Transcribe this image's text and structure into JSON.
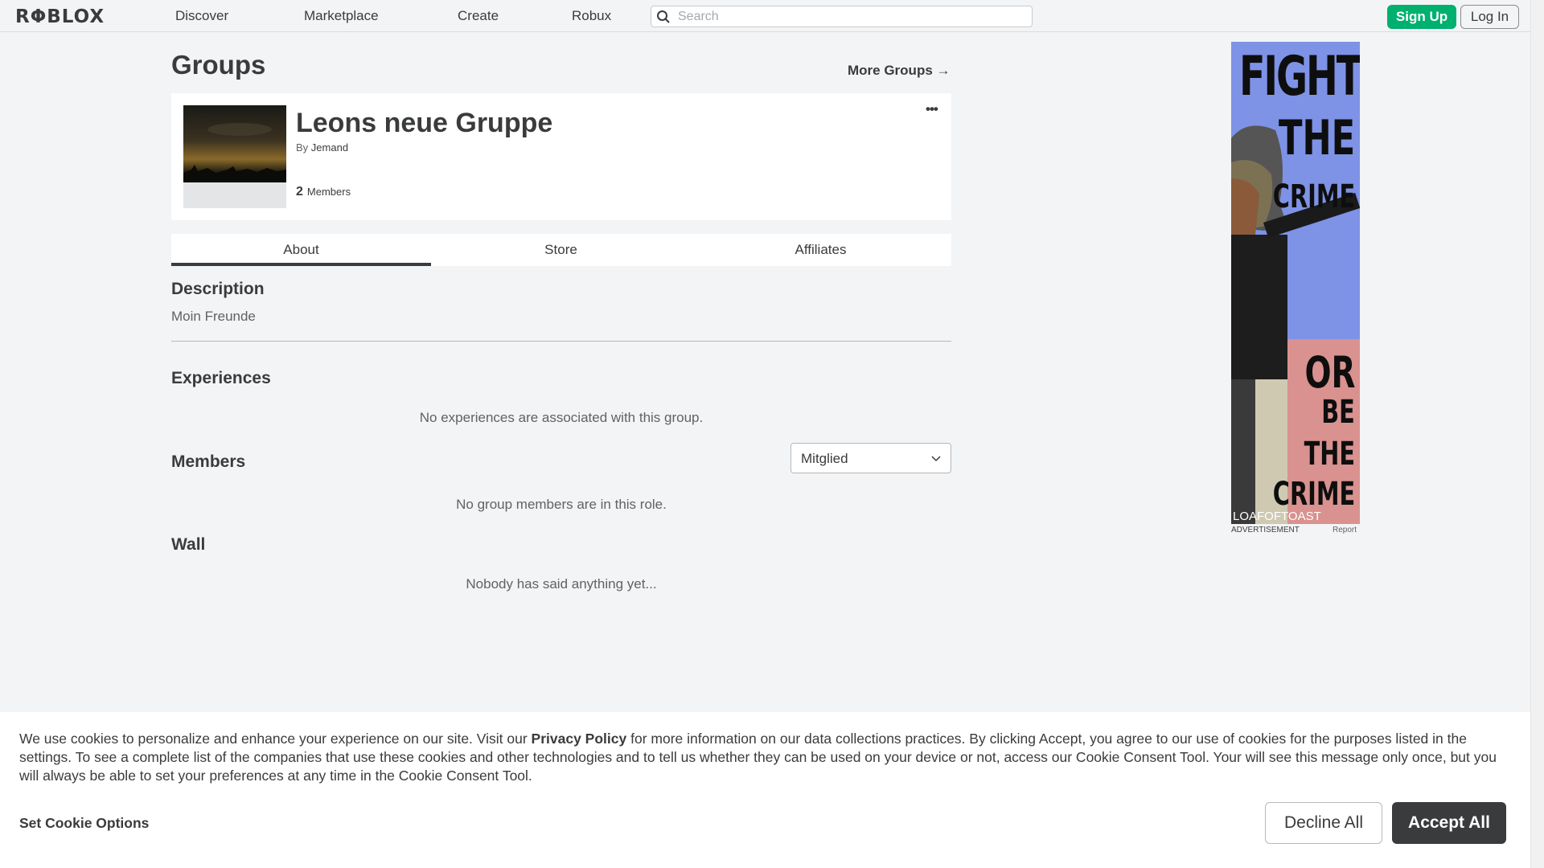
{
  "header": {
    "logo": "RΦBLOX",
    "nav": [
      "Discover",
      "Marketplace",
      "Create",
      "Robux"
    ],
    "search_placeholder": "Search",
    "signup": "Sign Up",
    "login": "Log In"
  },
  "page": {
    "title": "Groups",
    "more_groups": "More Groups →"
  },
  "group": {
    "name": "Leons neue Gruppe",
    "by_label": "By",
    "owner": "Jemand",
    "member_count": "2",
    "members_label": "Members",
    "menu": "•••"
  },
  "tabs": [
    "About",
    "Store",
    "Affiliates"
  ],
  "about": {
    "description_title": "Description",
    "description": "Moin Freunde",
    "experiences_title": "Experiences",
    "experiences_empty": "No experiences are associated with this group.",
    "members_title": "Members",
    "role_selected": "Mitglied",
    "members_empty": "No group members are in this role.",
    "wall_title": "Wall",
    "wall_empty": "Nobody has said anything yet..."
  },
  "ad": {
    "words_top": [
      "FIGHT",
      "THE",
      "CRIME"
    ],
    "words_bottom": [
      "OR",
      "BE",
      "THE",
      "CRIME"
    ],
    "credit": "LOAFOFTOAST",
    "label": "ADVERTISEMENT",
    "report": "Report"
  },
  "cookie": {
    "text_before": "We use cookies to personalize and enhance your experience on our site. Visit our ",
    "policy_link": "Privacy Policy",
    "text_after": " for more information on our data collections practices. By clicking Accept, you agree to our use of cookies for the purposes listed in the settings. To see a complete list of the companies that use these cookies and other technologies and to tell us whether they can be used on your device or not, access our Cookie Consent Tool. Your will see this message only once, but you will always be able to set your preferences at any time in the Cookie Consent Tool.",
    "options": "Set Cookie Options",
    "decline": "Decline All",
    "accept": "Accept All"
  },
  "colors": {
    "accent_green": "#00b06f",
    "text_dark": "#393b3d",
    "ad_blue": "#7e92e6",
    "ad_pink": "#d9928f"
  }
}
